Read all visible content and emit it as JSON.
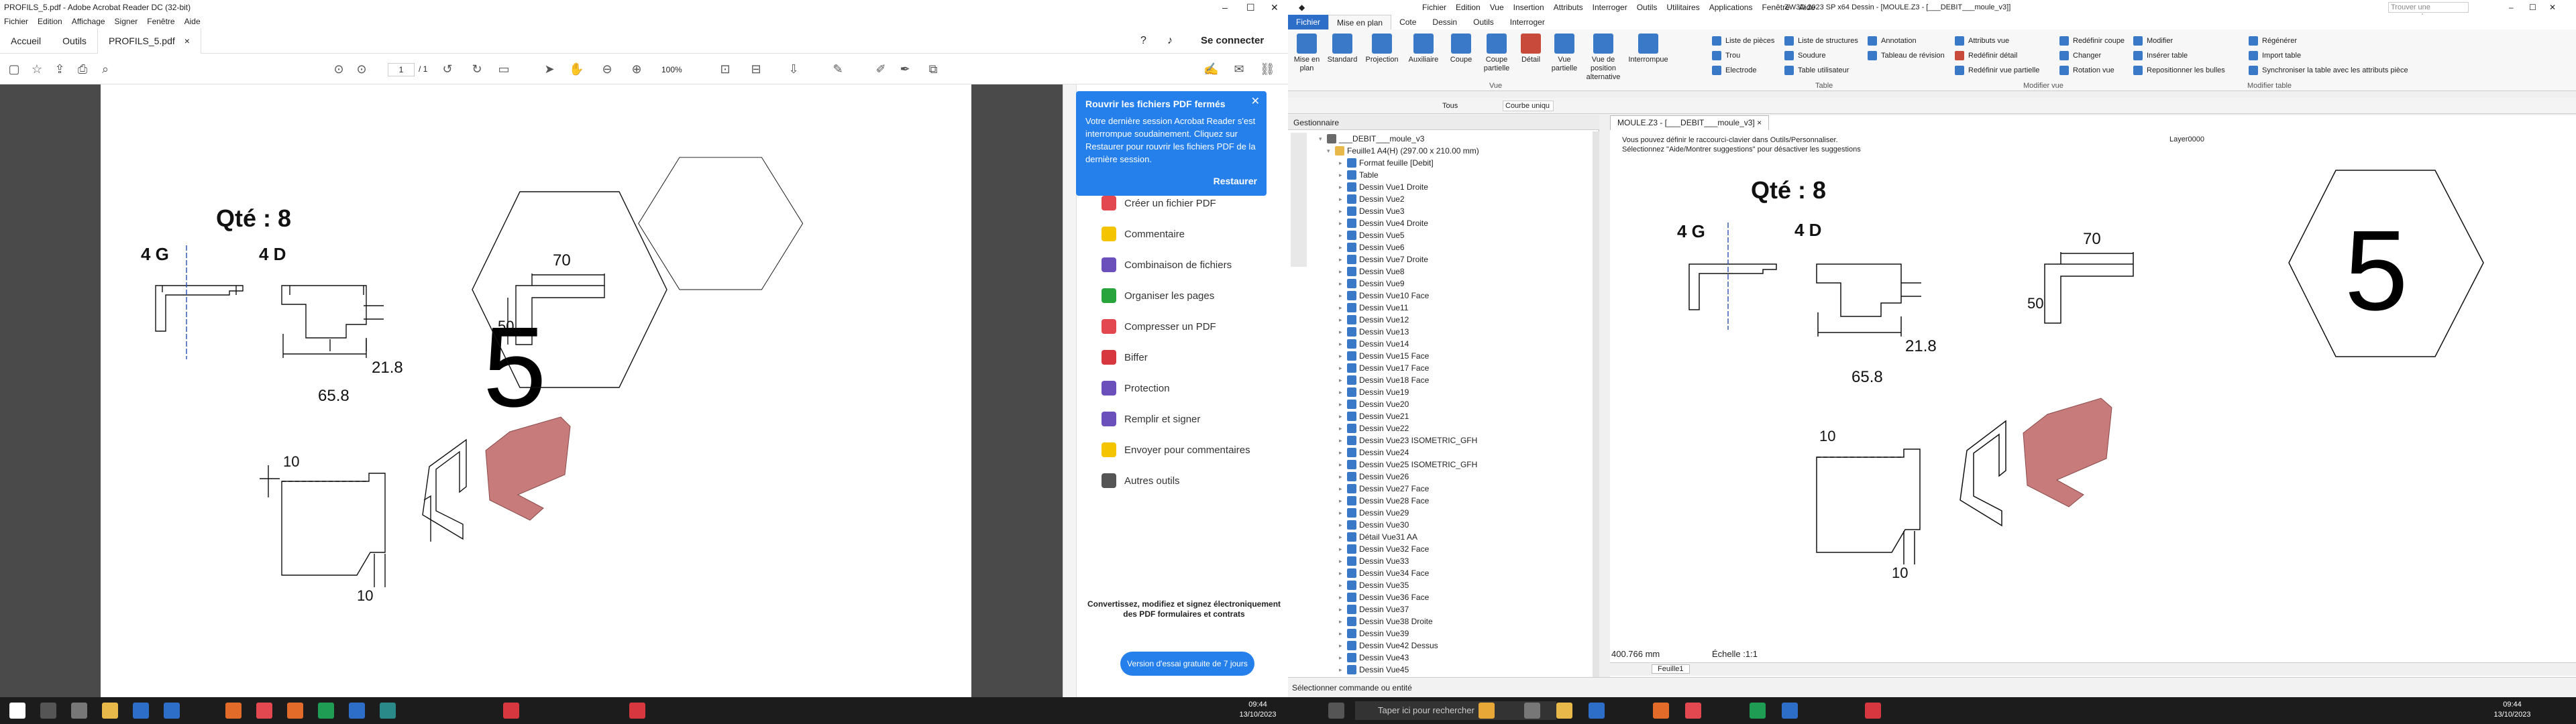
{
  "acrobat": {
    "title": "PROFILS_5.pdf - Adobe Acrobat Reader DC (32-bit)",
    "menu": [
      "Fichier",
      "Edition",
      "Affichage",
      "Signer",
      "Fenêtre",
      "Aide"
    ],
    "tabs": {
      "home": "Accueil",
      "tools": "Outils",
      "doc": "PROFILS_5.pdf"
    },
    "signin": "Se connecter",
    "page_current": "1",
    "page_total": "/ 1",
    "zoom": "100%",
    "popup": {
      "title": "Rouvrir les fichiers PDF fermés",
      "body": "Votre dernière session Acrobat Reader s'est interrompue soudainement. Cliquez sur Restaurer pour rouvrir les fichiers PDF de la dernière session.",
      "button": "Restaurer"
    },
    "tools": [
      {
        "label": "Créer un fichier PDF",
        "color": "#e34850"
      },
      {
        "label": "Commentaire",
        "color": "#f5c400"
      },
      {
        "label": "Combinaison de fichiers",
        "color": "#6b4fbb"
      },
      {
        "label": "Organiser les pages",
        "color": "#27a43c"
      },
      {
        "label": "Compresser un PDF",
        "color": "#e34850"
      },
      {
        "label": "Biffer",
        "color": "#d7373f"
      },
      {
        "label": "Protection",
        "color": "#6b4fbb"
      },
      {
        "label": "Remplir et signer",
        "color": "#6b4fbb"
      },
      {
        "label": "Envoyer pour commentaires",
        "color": "#f5c400"
      },
      {
        "label": "Autres outils",
        "color": "#555555"
      }
    ],
    "promo_text": "Convertissez, modifiez et signez électroniquement des PDF formulaires et contrats",
    "promo_button": "Version d'essai gratuite de 7 jours"
  },
  "drawing": {
    "qty": "Qté : 8",
    "left_label": "4 G",
    "right_label": "4 D",
    "number": "5",
    "dims": {
      "d70": "70",
      "d50": "50",
      "d21": "21.8",
      "d65": "65.8",
      "d10": "10"
    }
  },
  "zw3d": {
    "title": "ZW3D 2023 SP x64     Dessin - [MOULE.Z3 - [___DEBIT___moule_v3]]",
    "menu": [
      "Fichier",
      "Edition",
      "Vue",
      "Insertion",
      "Attributs",
      "Interroger",
      "Outils",
      "Utilitaires",
      "Applications",
      "Fenêtre",
      "Aide"
    ],
    "search_placeholder": "Trouver une commande",
    "ribbon_tabs": [
      "Fichier",
      "Mise en plan",
      "Cote",
      "Dessin",
      "Outils",
      "Interroger"
    ],
    "ribbon_big": [
      "Mise en plan",
      "Standard",
      "Projection",
      "Auxiliaire",
      "Coupe",
      "Coupe partielle",
      "Détail",
      "Vue partielle",
      "Vue de position alternative",
      "Interrompue"
    ],
    "ribbon_small": [
      "Liste de pièces",
      "Trou",
      "Electrode",
      "Liste de structures",
      "Soudure",
      "Table utilisateur",
      "Annotation",
      "Tableau de révision",
      "Attributs vue",
      "Redéfinir détail",
      "Redéfinir vue partielle",
      "Redéfinir coupe",
      "Changer",
      "Rotation vue",
      "Modifier",
      "Insérer table",
      "Repositionner les bulles",
      "Régénérer",
      "Import table",
      "Synchroniser la table avec les attributs pièce"
    ],
    "groups": [
      "Vue",
      "Table",
      "Modifier vue",
      "Modifier table"
    ],
    "filter_all": "Tous",
    "filter_curve": "Courbe uniqu",
    "manager_title": "Gestionnaire",
    "tree_root": "___DEBIT___moule_v3",
    "tree_sheet": "Feuille1 A4(H) (297.00 x 210.00 mm)",
    "tree_items": [
      "Format feuille [Debit]",
      "Table",
      "Dessin Vue1 Droite",
      "Dessin Vue2",
      "Dessin Vue3",
      "Dessin Vue4 Droite",
      "Dessin Vue5",
      "Dessin Vue6",
      "Dessin Vue7 Droite",
      "Dessin Vue8",
      "Dessin Vue9",
      "Dessin Vue10 Face",
      "Dessin Vue11",
      "Dessin Vue12",
      "Dessin Vue13",
      "Dessin Vue14",
      "Dessin Vue15 Face",
      "Dessin Vue17 Face",
      "Dessin Vue18 Face",
      "Dessin Vue19",
      "Dessin Vue20",
      "Dessin Vue21",
      "Dessin Vue22",
      "Dessin Vue23 ISOMETRIC_GFH",
      "Dessin Vue24",
      "Dessin Vue25 ISOMETRIC_GFH",
      "Dessin Vue26",
      "Dessin Vue27 Face",
      "Dessin Vue28 Face",
      "Dessin Vue29",
      "Dessin Vue30",
      "Détail Vue31 AA",
      "Dessin Vue32 Face",
      "Dessin Vue33",
      "Dessin Vue34 Face",
      "Dessin Vue35",
      "Dessin Vue36 Face",
      "Dessin Vue37",
      "Dessin Vue38 Droite",
      "Dessin Vue39",
      "Dessin Vue42 Dessus",
      "Dessin Vue43",
      "Dessin Vue45"
    ],
    "view_tab": "MOULE.Z3 - [___DEBIT___moule_v3]",
    "hint1": "Vous pouvez définir le raccourci-clavier dans Outils/Personnaliser.",
    "hint2": "Sélectionnez \"Aide/Montrer suggestions\" pour désactiver les suggestions",
    "layer": "Layer0000",
    "coord": "400.766 mm",
    "scale": "Échelle :1:1",
    "sheet_tab": "Feuille1",
    "status": "Sélectionner commande ou entité"
  },
  "taskbar": {
    "search_placeholder": "Taper ici pour rechercher",
    "time": "09:44",
    "date": "13/10/2023"
  }
}
